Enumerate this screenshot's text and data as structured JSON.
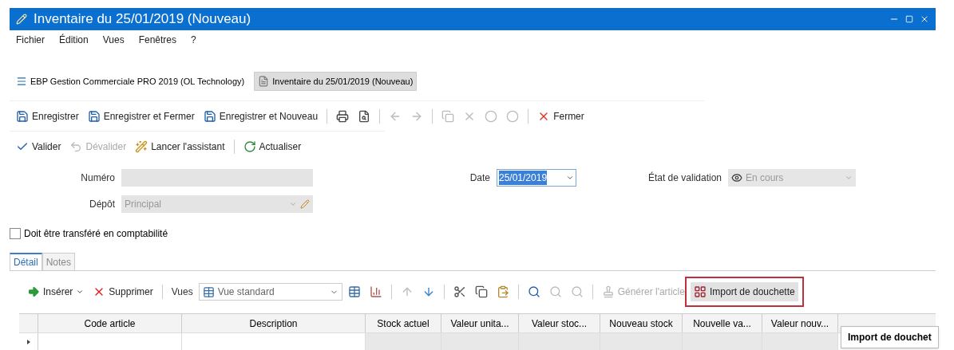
{
  "window": {
    "title": "Inventaire du 25/01/2019 (Nouveau)"
  },
  "menu": [
    "Fichier",
    "Édition",
    "Vues",
    "Fenêtres",
    "?"
  ],
  "doc_tabs": [
    {
      "label": "EBP Gestion Commerciale PRO 2019 (OL Technology)",
      "kind": "app",
      "selected": false
    },
    {
      "label": "Inventaire du 25/01/2019 (Nouveau)",
      "kind": "doc",
      "selected": true
    }
  ],
  "toolbar_1": [
    {
      "kind": "save",
      "label": "Enregistrer",
      "disabled": false
    },
    {
      "kind": "save-close",
      "label": "Enregistrer et Fermer",
      "disabled": false
    },
    {
      "kind": "save-new",
      "label": "Enregistrer et Nouveau",
      "disabled": false
    },
    {
      "kind": "separator"
    },
    {
      "kind": "print",
      "disabled": false
    },
    {
      "kind": "preview",
      "disabled": false
    },
    {
      "kind": "separator"
    },
    {
      "kind": "back",
      "disabled": true
    },
    {
      "kind": "forward",
      "disabled": true
    },
    {
      "kind": "separator"
    },
    {
      "kind": "copy",
      "disabled": true
    },
    {
      "kind": "delete",
      "disabled": true
    },
    {
      "kind": "circle",
      "disabled": true
    },
    {
      "kind": "circle",
      "disabled": true
    },
    {
      "kind": "separator"
    },
    {
      "kind": "close",
      "label": "Fermer",
      "disabled": false
    }
  ],
  "toolbar_2": [
    {
      "kind": "validate",
      "label": "Valider",
      "disabled": false
    },
    {
      "kind": "unvalidate",
      "label": "Dévalider",
      "disabled": true
    },
    {
      "kind": "wizard",
      "label": "Lancer l'assistant",
      "disabled": false
    },
    {
      "kind": "separator"
    },
    {
      "kind": "refresh",
      "label": "Actualiser",
      "disabled": false
    }
  ],
  "form": {
    "numero": {
      "label": "Numéro",
      "disabled": true
    },
    "depot": {
      "label": "Dépôt",
      "value": "Principal",
      "disabled": true
    },
    "date": {
      "label": "Date",
      "value": "25/01/2019"
    },
    "etat": {
      "label": "État de validation",
      "value": "En cours",
      "disabled": true
    }
  },
  "transfer_checkbox": {
    "label": "Doit être transféré en comptabilité",
    "checked": false
  },
  "tabs": [
    {
      "label": "Détail",
      "selected": true
    },
    {
      "label": "Notes",
      "selected": false
    }
  ],
  "grid_toolbar": [
    {
      "kind": "insert",
      "label": "Insérer",
      "disabled": false,
      "dropdown": true
    },
    {
      "kind": "remove",
      "label": "Supprimer",
      "disabled": false
    },
    {
      "kind": "separator"
    },
    {
      "kind": "text",
      "label": "Vues"
    },
    {
      "kind": "view-select",
      "label": "Vue standard"
    },
    {
      "kind": "grid-settings",
      "disabled": false
    },
    {
      "kind": "grid-chart",
      "disabled": false
    },
    {
      "kind": "separator"
    },
    {
      "kind": "up",
      "disabled": true
    },
    {
      "kind": "down",
      "disabled": false
    },
    {
      "kind": "separator"
    },
    {
      "kind": "cut",
      "disabled": false
    },
    {
      "kind": "copy",
      "disabled": false
    },
    {
      "kind": "paste",
      "disabled": false
    },
    {
      "kind": "separator"
    },
    {
      "kind": "search",
      "disabled": false
    },
    {
      "kind": "search",
      "disabled": true
    },
    {
      "kind": "search",
      "disabled": true
    },
    {
      "kind": "separator"
    },
    {
      "kind": "generate",
      "label": "Générer l'article",
      "disabled": true
    },
    {
      "kind": "scanner",
      "label": "Import de douchette",
      "disabled": false,
      "highlighted": true
    }
  ],
  "table": {
    "columns": [
      "Code article",
      "Description",
      "Stock actuel",
      "Valeur unita...",
      "Valeur stoc...",
      "Nouveau stock",
      "Nouvelle va...",
      "Valeur nouv..."
    ]
  },
  "tooltip": "Import de douchet"
}
